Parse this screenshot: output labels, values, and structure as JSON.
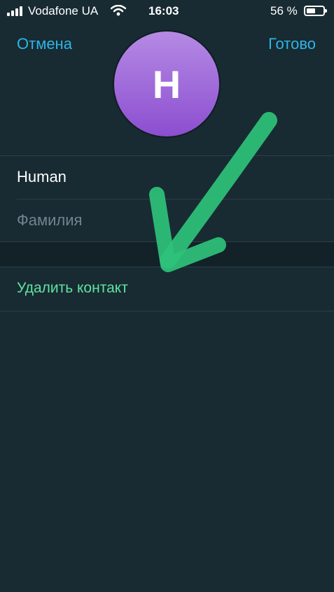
{
  "status_bar": {
    "carrier": "Vodafone UA",
    "time": "16:03",
    "battery_percent": "56 %",
    "battery_level": 0.56,
    "icons": [
      "signal-icon",
      "wifi-icon",
      "battery-icon"
    ]
  },
  "nav": {
    "cancel_label": "Отмена",
    "done_label": "Готово",
    "accent_color": "#2cb5e8"
  },
  "avatar": {
    "initial": "H",
    "gradient_top": "#b58ae4",
    "gradient_bottom": "#8c4ed0"
  },
  "form": {
    "first_name_value": "Human",
    "last_name_placeholder": "Фамилия"
  },
  "actions": {
    "delete_label": "Удалить контакт",
    "delete_color": "#5fe3a0"
  },
  "annotation": {
    "arrow_color": "#2fc27a"
  },
  "colors": {
    "background": "#182b32",
    "separator": "#2a3f47"
  }
}
